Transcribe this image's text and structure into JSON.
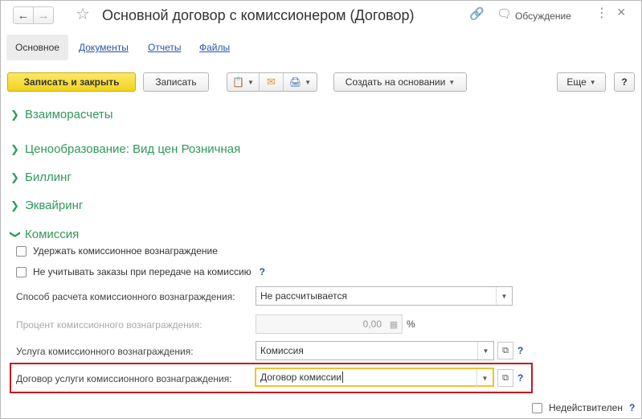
{
  "window": {
    "title": "Основной договор с комиссионером (Договор)",
    "discussion_label": "Обсуждение"
  },
  "tabs": [
    {
      "label": "Основное",
      "active": true
    },
    {
      "label": "Документы",
      "active": false
    },
    {
      "label": "Отчеты",
      "active": false
    },
    {
      "label": "Файлы",
      "active": false
    }
  ],
  "toolbar": {
    "save_close_label": "Записать и закрыть",
    "save_label": "Записать",
    "create_basis_label": "Создать на основании",
    "more_label": "Еще",
    "help_label": "?"
  },
  "sections": [
    {
      "label": "Взаиморасчеты",
      "expanded": false
    },
    {
      "label": "Ценообразование: Вид цен Розничная",
      "expanded": false
    },
    {
      "label": "Биллинг",
      "expanded": false
    },
    {
      "label": "Эквайринг",
      "expanded": false
    },
    {
      "label": "Комиссия",
      "expanded": true
    }
  ],
  "commission": {
    "withhold_label": "Удержать комиссионное вознаграждение",
    "withhold_checked": false,
    "ignore_orders_label": "Не учитывать заказы при передаче на комиссию",
    "ignore_orders_checked": false,
    "calc_method_label": "Способ расчета комиссионного вознаграждения:",
    "calc_method_value": "Не рассчитывается",
    "percent_label": "Процент комиссионного вознаграждения:",
    "percent_value": "0,00",
    "percent_unit": "%",
    "service_label": "Услуга комиссионного вознаграждения:",
    "service_value": "Комиссия",
    "contract_label": "Договор услуги комиссионного вознаграждения:",
    "contract_value": "Договор комиссии",
    "help": "?"
  },
  "footer": {
    "invalid_label": "Недействителен",
    "invalid_checked": false,
    "help": "?"
  },
  "colors": {
    "accent_green": "#2f9a5b",
    "primary_button": "#f2d31c",
    "highlight_red": "#c8161d",
    "focus_yellow": "#f1c232",
    "link_blue": "#2a54a6"
  }
}
